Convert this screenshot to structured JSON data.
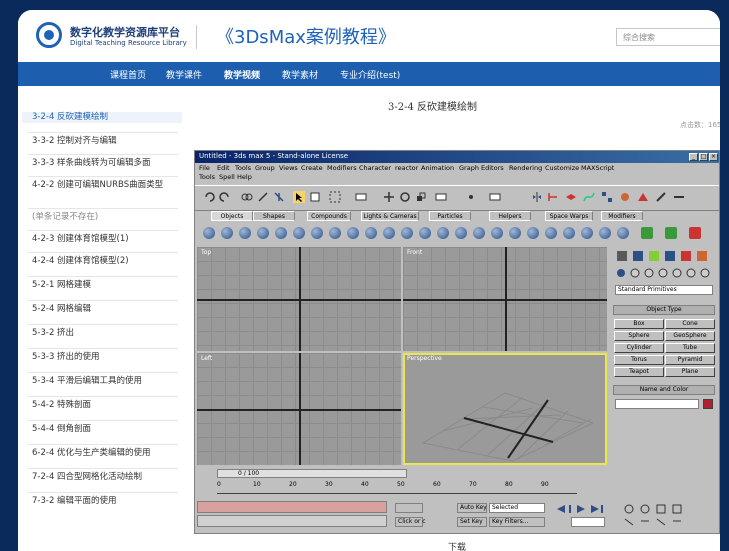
{
  "header": {
    "brand_title": "数字化教学资源库平台",
    "brand_subtitle": "Digital Teaching Resource Library",
    "course_title": "《3DsMax案例教程》",
    "search_placeholder": "综合搜索"
  },
  "nav": {
    "items": [
      "课程首页",
      "教学课件",
      "教学视频",
      "教学素材",
      "专业介绍(test)"
    ],
    "active_index": 2
  },
  "sidebar": {
    "items": [
      {
        "label": "3-2-4 反砍建模绘制",
        "active": true
      },
      {
        "label": "3-3-2 控制对齐与编辑"
      },
      {
        "label": "3-3-3 样条曲线转为可编辑多面"
      },
      {
        "label": "4-2-2 创建可编辑NURBS曲面类型"
      },
      {
        "label": "(单条记录不存在)",
        "muted": true
      },
      {
        "label": "4-2-3 创建体育馆模型(1)"
      },
      {
        "label": "4-2-4 创建体育馆模型(2)"
      },
      {
        "label": "5-2-1 网格建模"
      },
      {
        "label": "5-2-4 网格编辑"
      },
      {
        "label": "5-3-2 挤出"
      },
      {
        "label": "5-3-3 挤出的使用"
      },
      {
        "label": "5-3-4 平滑后编辑工具的使用"
      },
      {
        "label": "5-4-2 特殊剖面"
      },
      {
        "label": "5-4-4 倒角剖面"
      },
      {
        "label": "6-2-4 优化与生产类编辑的使用"
      },
      {
        "label": "7-2-4 四合型网格化活动绘制"
      },
      {
        "label": "7-3-2 编辑平面的使用"
      }
    ]
  },
  "content": {
    "page_title": "3-2-4 反砍建模绘制",
    "visits": "点击数：165",
    "caption": "下载"
  },
  "max_window": {
    "title": "Untitled - 3ds max 5 - Stand-alone License",
    "menu_row1": [
      "File",
      "Edit",
      "Tools",
      "Group",
      "Views",
      "Create",
      "Modifiers",
      "Character",
      "reactor",
      "Animation",
      "Graph Editors",
      "Rendering",
      "Customize",
      "MAXScript"
    ],
    "menu_row2": [
      "Tools",
      "Spell",
      "Help"
    ],
    "tabs": [
      "Objects",
      "Shapes",
      "Compounds",
      "Lights & Cameras",
      "Particles",
      "Helpers",
      "Space Warps",
      "Modifiers"
    ],
    "viewports": [
      "Top",
      "Front",
      "Left",
      "Perspective"
    ],
    "create_type_dropdown": "Standard Primitives",
    "object_type_header": "Object Type",
    "object_buttons": [
      "Box",
      "Cone",
      "Sphere",
      "GeoSphere",
      "Cylinder",
      "Tube",
      "Torus",
      "Pyramid",
      "Teapot",
      "Plane"
    ],
    "name_color_header": "Name and Color",
    "time_slider": "0 / 100",
    "ruler_ticks": [
      "0",
      "10",
      "20",
      "30",
      "40",
      "50",
      "60",
      "70",
      "80",
      "90"
    ],
    "auto_key_label": "Auto Key",
    "set_key_label": "Set Key",
    "selected_label": "Selected",
    "key_filters_label": "Key Filters...",
    "click_label": "Click or c"
  },
  "colors": {
    "nav_bg": "#1d5fae",
    "brand_blue": "#1e63b8",
    "active_viewport": "#e8e84a"
  }
}
